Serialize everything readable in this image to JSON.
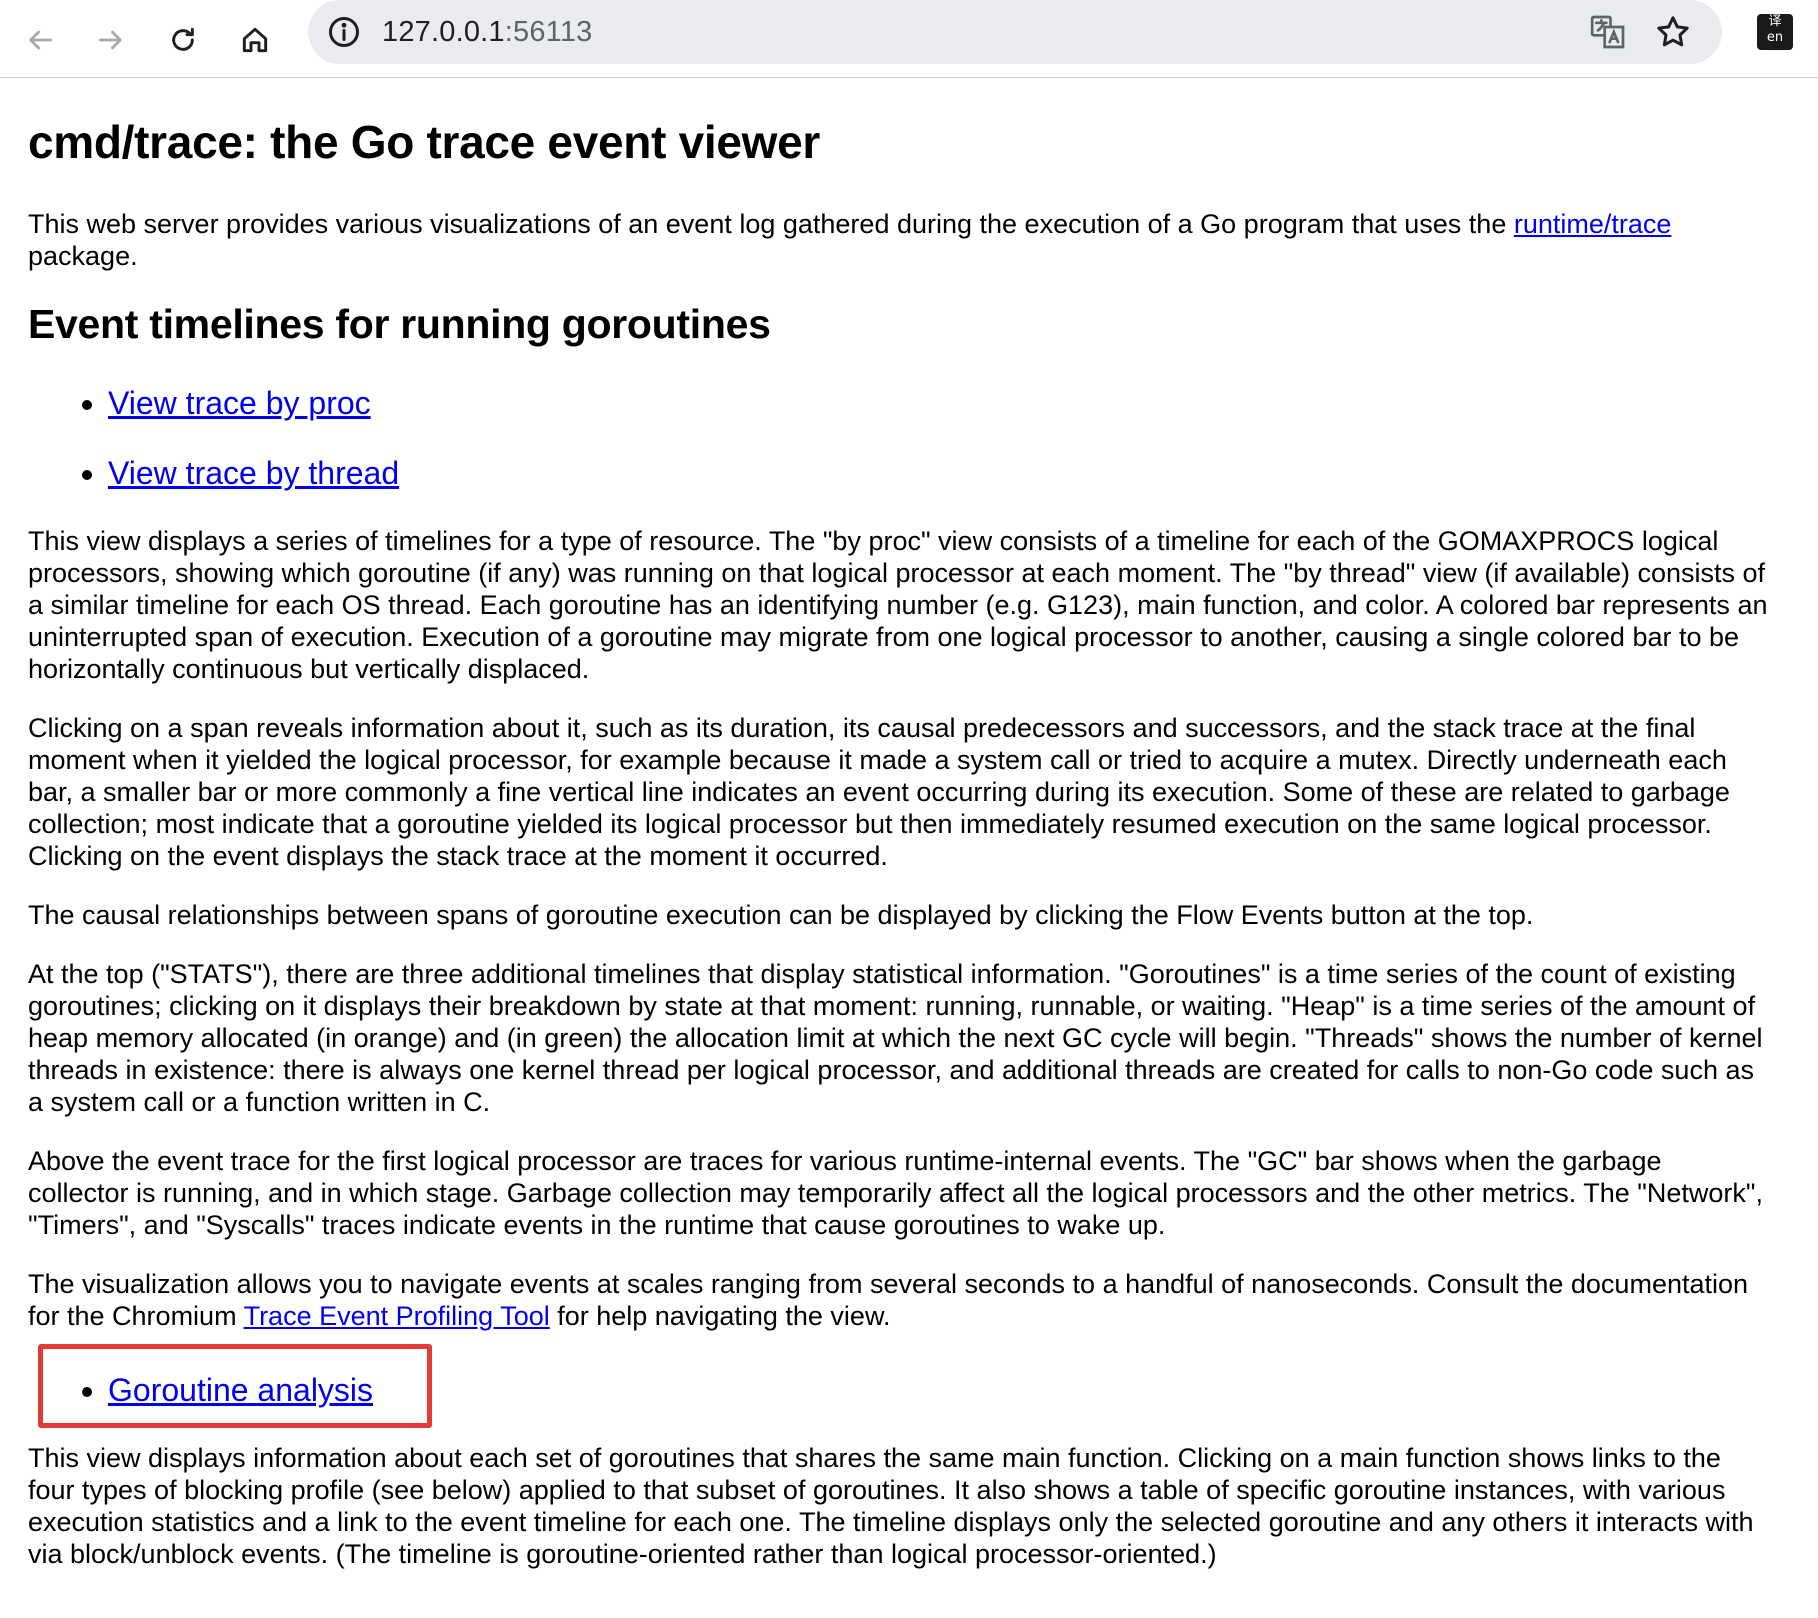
{
  "browser": {
    "url_host": "127.0.0.1",
    "url_port": ":56113",
    "icons": {
      "back": "arrow-left-icon",
      "forward": "arrow-right-icon",
      "reload": "reload-icon",
      "home": "home-icon",
      "site_info": "info-icon",
      "translate": "translate-icon",
      "bookmark": "star-icon",
      "extension": "extension-icon"
    },
    "extension_label_top": "译",
    "extension_label_bottom": "en"
  },
  "page": {
    "title": "cmd/trace: the Go trace event viewer",
    "intro_before": "This web server provides various visualizations of an event log gathered during the execution of a Go program that uses the ",
    "intro_link": "runtime/trace",
    "intro_after": " package.",
    "section_title": "Event timelines for running goroutines",
    "timeline_links": [
      {
        "label": "View trace by proc"
      },
      {
        "label": "View trace by thread"
      }
    ],
    "paragraphs": [
      "This view displays a series of timelines for a type of resource. The \"by proc\" view consists of a timeline for each of the GOMAXPROCS logical processors, showing which goroutine (if any) was running on that logical processor at each moment. The \"by thread\" view (if available) consists of a similar timeline for each OS thread. Each goroutine has an identifying number (e.g. G123), main function, and color. A colored bar represents an uninterrupted span of execution. Execution of a goroutine may migrate from one logical processor to another, causing a single colored bar to be horizontally continuous but vertically displaced.",
      "Clicking on a span reveals information about it, such as its duration, its causal predecessors and successors, and the stack trace at the final moment when it yielded the logical processor, for example because it made a system call or tried to acquire a mutex. Directly underneath each bar, a smaller bar or more commonly a fine vertical line indicates an event occurring during its execution. Some of these are related to garbage collection; most indicate that a goroutine yielded its logical processor but then immediately resumed execution on the same logical processor. Clicking on the event displays the stack trace at the moment it occurred.",
      "The causal relationships between spans of goroutine execution can be displayed by clicking the Flow Events button at the top.",
      "At the top (\"STATS\"), there are three additional timelines that display statistical information. \"Goroutines\" is a time series of the count of existing goroutines; clicking on it displays their breakdown by state at that moment: running, runnable, or waiting. \"Heap\" is a time series of the amount of heap memory allocated (in orange) and (in green) the allocation limit at which the next GC cycle will begin. \"Threads\" shows the number of kernel threads in existence: there is always one kernel thread per logical processor, and additional threads are created for calls to non-Go code such as a system call or a function written in C.",
      "Above the event trace for the first logical processor are traces for various runtime-internal events. The \"GC\" bar shows when the garbage collector is running, and in which stage. Garbage collection may temporarily affect all the logical processors and the other metrics. The \"Network\", \"Timers\", and \"Syscalls\" traces indicate events in the runtime that cause goroutines to wake up."
    ],
    "viz_before": "The visualization allows you to navigate events at scales ranging from several seconds to a handful of nanoseconds. Consult the documentation for the Chromium ",
    "viz_link": "Trace Event Profiling Tool",
    "viz_after": " for help navigating the view.",
    "goroutine_link": "Goroutine analysis",
    "goroutine_paragraph": "This view displays information about each set of goroutines that shares the same main function. Clicking on a main function shows links to the four types of blocking profile (see below) applied to that subset of goroutines. It also shows a table of specific goroutine instances, with various execution statistics and a link to the event timeline for each one. The timeline displays only the selected goroutine and any others it interacts with via block/unblock events. (The timeline is goroutine-oriented rather than logical processor-oriented.)",
    "highlight_color": "#e23a35",
    "link_color": "#0000ee"
  }
}
